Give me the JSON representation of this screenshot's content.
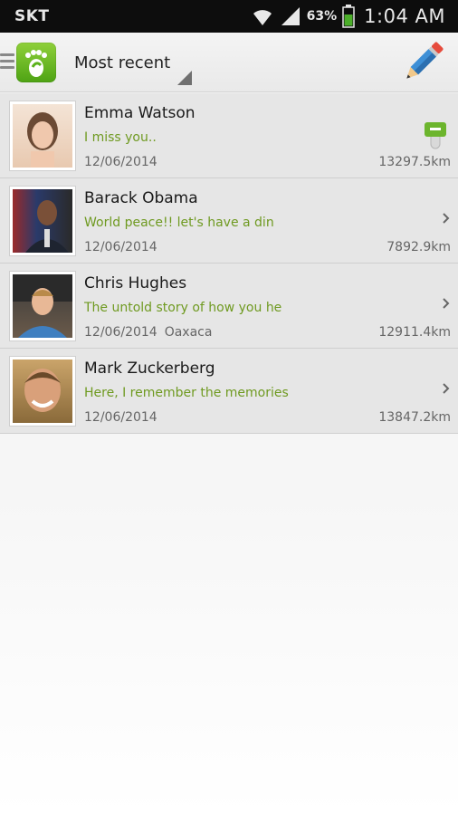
{
  "status_bar": {
    "carrier": "SKT",
    "battery_percent": "63%",
    "time": "1:04 AM",
    "icons": [
      "wifi-icon",
      "signal-icon",
      "battery-icon"
    ]
  },
  "header": {
    "sort_selected": "Most recent",
    "menu_icon": "menu-icon",
    "logo_icon": "app-logo-footprint",
    "compose_icon": "pencil-icon"
  },
  "colors": {
    "preview_text": "#6f9a21",
    "logo_green": "#5cb21c",
    "list_bg": "#e6e6e6"
  },
  "messages": [
    {
      "name": "Emma Watson",
      "preview": "I miss you..",
      "date": "12/06/2014",
      "location": "",
      "distance": "13297.5km",
      "indicator": "lock-icon"
    },
    {
      "name": "Barack Obama",
      "preview": "World peace!! let's have a din",
      "date": "12/06/2014",
      "location": "",
      "distance": "7892.9km",
      "indicator": "chevron-right-icon"
    },
    {
      "name": "Chris Hughes",
      "preview": "The untold story of how you he",
      "date": "12/06/2014",
      "location": "Oaxaca",
      "distance": "12911.4km",
      "indicator": "chevron-right-icon"
    },
    {
      "name": "Mark Zuckerberg",
      "preview": "Here, I remember the memories",
      "date": "12/06/2014",
      "location": "",
      "distance": "13847.2km",
      "indicator": "chevron-right-icon"
    }
  ]
}
